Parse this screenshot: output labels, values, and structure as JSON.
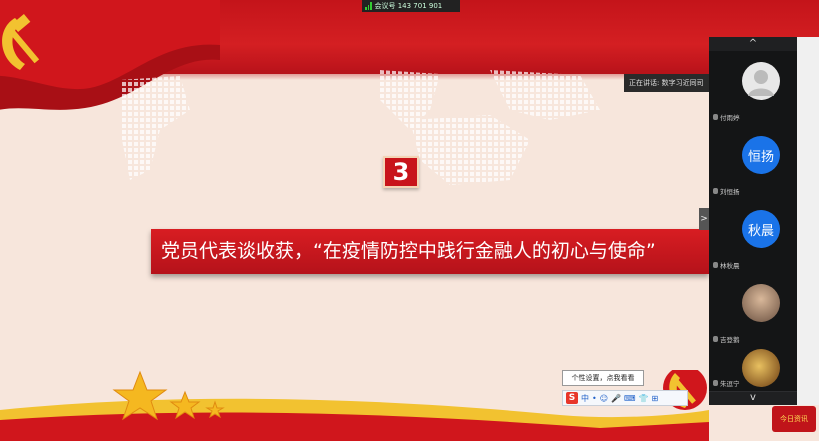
{
  "meeting": {
    "id_text": "会议号 143 701 901"
  },
  "slide": {
    "section_number": "3",
    "title": "党员代表谈收获，“在疫情防控中践行金融人的初心与使命”"
  },
  "speaker": {
    "text": "正在讲话: 数字习近同司"
  },
  "participants": [
    {
      "name": "付雨婷",
      "avatar_text": "",
      "avatar_color": "#e8e8e8",
      "type": "default"
    },
    {
      "name": "刘恒扬",
      "avatar_text": "恒扬",
      "avatar_color": "#1a73e8",
      "type": "initials"
    },
    {
      "name": "林秋晨",
      "avatar_text": "秋晨",
      "avatar_color": "#1a73e8",
      "type": "initials"
    },
    {
      "name": "吉登鹅",
      "avatar_text": "",
      "avatar_color": "#7a6a5a",
      "type": "photo"
    },
    {
      "name": "朱逗宁",
      "avatar_text": "",
      "avatar_color": "#b08030",
      "type": "photo"
    }
  ],
  "panel": {
    "up_arrow": "^",
    "down_arrow": "v",
    "toggle_arrow": ">"
  },
  "ime": {
    "tooltip": "个性设置，点我看看",
    "logo": "S",
    "mode": "中",
    "items": [
      "•",
      "◡",
      "☺",
      "🎤",
      "⌨",
      "⬇",
      "👕",
      "⊞"
    ]
  },
  "tray": {
    "label": "今日资讯"
  },
  "colors": {
    "primary_red": "#c8141b",
    "avatar_blue": "#1a73e8",
    "gold": "#f2c230"
  }
}
